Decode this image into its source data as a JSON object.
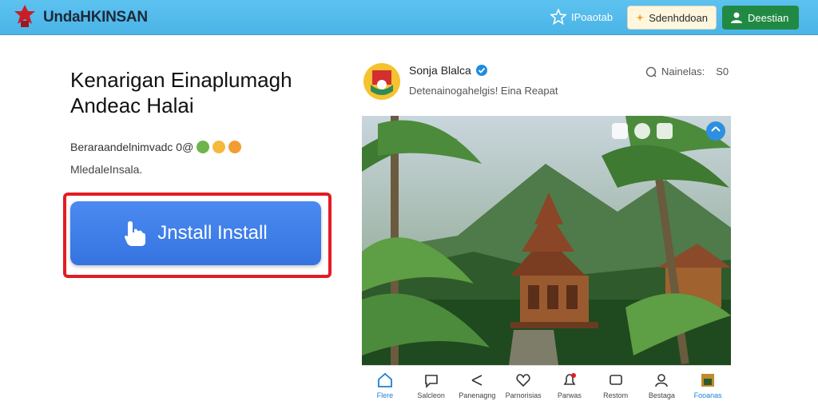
{
  "header": {
    "brand": "UndaHKINSAN",
    "favorite_label": "IPoaotab",
    "button_light_label": "Sdenhddoan",
    "button_green_label": "Deestian"
  },
  "hero": {
    "headline_line1": "Kenarigan Einaplumagh",
    "headline_line2": "Andeac Halai",
    "description": "Beraraandelnimvadc 0@",
    "subtext": "MledaleInsala.",
    "install_label": "Jnstall Install"
  },
  "post": {
    "author": "Sonja Blalca",
    "subtitle": "Detenainogahelgis! Eina Reapat",
    "stats_label": "Nainelas:",
    "stats_count": "S0"
  },
  "bottom_nav": [
    {
      "label": "Flere",
      "icon": "home-icon"
    },
    {
      "label": "Salcleon",
      "icon": "chat-icon"
    },
    {
      "label": "Panenagng",
      "icon": "share-icon"
    },
    {
      "label": "Parnorisias",
      "icon": "heart-icon"
    },
    {
      "label": "Parwas",
      "icon": "notification-icon"
    },
    {
      "label": "Restom",
      "icon": "message-icon"
    },
    {
      "label": "Bestaga",
      "icon": "profile-icon"
    },
    {
      "label": "Fooanas",
      "icon": "thumbnail-icon"
    }
  ],
  "colors": {
    "topbar": "#4bb4e6",
    "install_button": "#3574e0",
    "highlight": "#e31b23",
    "green_button": "#208a44"
  }
}
